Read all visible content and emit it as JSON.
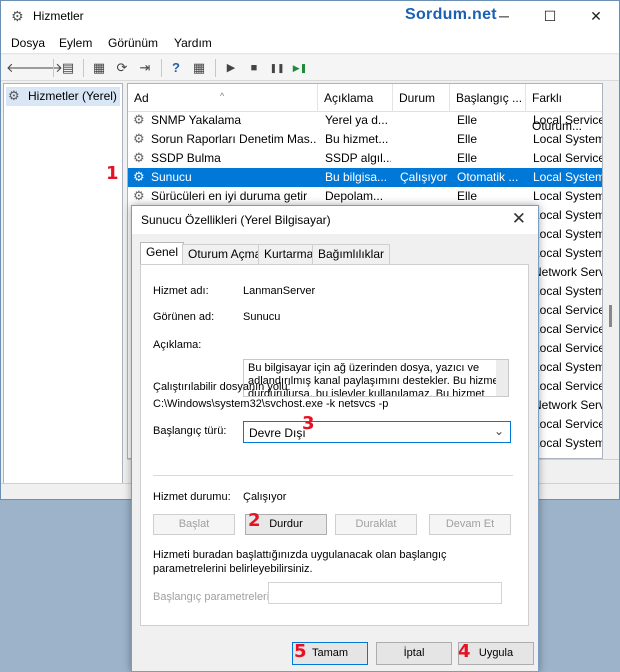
{
  "window": {
    "title": "Hizmetler",
    "watermark": "Sordum.net",
    "min_glyph": "─",
    "max_glyph": "☐",
    "close_glyph": "✕",
    "app_icon_glyph": "⚙"
  },
  "menu": [
    "Dosya",
    "Eylem",
    "Görünüm",
    "Yardım"
  ],
  "toolbar": {
    "back": "🡐",
    "forward": "🡒",
    "show_tree": "▤",
    "properties": "▦",
    "refresh": "⟳",
    "export": "⇥",
    "help": "?",
    "console": "▦",
    "play": "▶",
    "stop": "■",
    "pause": "❚❚",
    "resume": "▶❚"
  },
  "tree": {
    "item": "Hizmetler (Yerel)",
    "icon": "⚙"
  },
  "list": {
    "columns": [
      "Ad",
      "Açıklama",
      "Durum",
      "Başlangıç ...",
      "Farklı Oturum..."
    ],
    "sort_arrow": "^",
    "gear": "⚙",
    "rows": [
      {
        "name": "SNMP Yakalama",
        "desc": "Yerel ya d...",
        "status": "",
        "startup": "Elle",
        "logon": "Local Service"
      },
      {
        "name": "Sorun Raporları Denetim Mas...",
        "desc": "Bu hizmet...",
        "status": "",
        "startup": "Elle",
        "logon": "Local System"
      },
      {
        "name": "SSDP Bulma",
        "desc": "SSDP algıl...",
        "status": "",
        "startup": "Elle",
        "logon": "Local Service"
      },
      {
        "name": "Sunucu",
        "desc": "Bu bilgisa...",
        "status": "Çalışıyor",
        "startup": "Otomatik ...",
        "logon": "Local System"
      },
      {
        "name": "Sürücüleri en iyi duruma getir",
        "desc": "Depolam...",
        "status": "",
        "startup": "Elle",
        "logon": "Local System"
      }
    ],
    "right_visible": [
      "Local System",
      "Local System",
      "Local System",
      "Network Servi",
      "Local System",
      "Local Service",
      "Local Service",
      "Local Service",
      "Local System",
      "Local Service",
      "Network Servi",
      "Local Service",
      "Local System"
    ]
  },
  "annotations": {
    "n1": "1",
    "n2": "2",
    "n3": "3",
    "n4": "4",
    "n5": "5"
  },
  "dialog": {
    "title": "Sunucu Özellikleri (Yerel Bilgisayar)",
    "close": "✕",
    "tabs": [
      "Genel",
      "Oturum Açma",
      "Kurtarma",
      "Bağımlılıklar"
    ],
    "service_name_label": "Hizmet adı:",
    "service_name": "LanmanServer",
    "display_name_label": "Görünen ad:",
    "display_name": "Sunucu",
    "description_label": "Açıklama:",
    "description": "Bu bilgisayar için ağ üzerinden dosya, yazıcı ve adlandırılmış kanal paylaşımını destekler. Bu hizmet durdurulursa, bu işlevler kullanılamaz. Bu hizmet",
    "exe_path_label": "Çalıştırılabilir dosyanın yolu:",
    "exe_path": "C:\\Windows\\system32\\svchost.exe -k netsvcs -p",
    "startup_type_label": "Başlangıç türü:",
    "startup_type": "Devre Dışı",
    "dropdown_glyph": "⌄",
    "service_status_label": "Hizmet durumu:",
    "service_status": "Çalışıyor",
    "btn_start": "Başlat",
    "btn_stop": "Durdur",
    "btn_pause": "Duraklat",
    "btn_resume": "Devam Et",
    "help_text": "Hizmeti buradan başlattığınızda uygulanacak olan başlangıç parametrelerini belirleyebilirsiniz.",
    "params_label": "Başlangıç parametreleri:",
    "params_value": "",
    "btn_ok": "Tamam",
    "btn_cancel": "İptal",
    "btn_apply": "Uygula"
  }
}
